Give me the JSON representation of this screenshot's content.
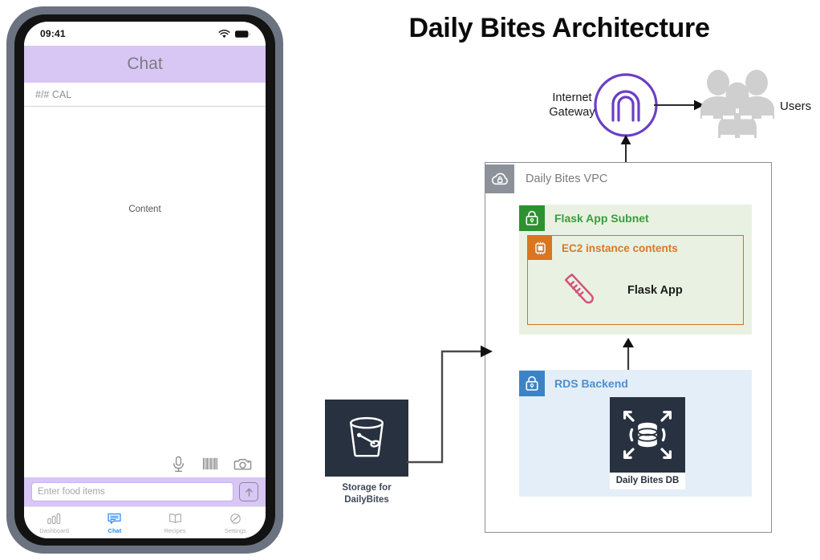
{
  "phone": {
    "status_bar": {
      "time": "09:41",
      "wifi_icon": "wifi-icon",
      "battery_icon": "battery-icon"
    },
    "header": {
      "title": "Chat"
    },
    "cal_row": {
      "text": "#/# CAL"
    },
    "body": {
      "content_label": "Content"
    },
    "media_row": [
      {
        "icon": "microphone-icon",
        "name": "microphone"
      },
      {
        "icon": "barcode-icon",
        "name": "barcode"
      },
      {
        "icon": "camera-icon",
        "name": "camera"
      }
    ],
    "composer": {
      "input_placeholder": "Enter food items",
      "input_value": "",
      "send_icon": "arrow-up-icon"
    },
    "tabs": [
      {
        "label": "Dashboard",
        "icon": "bar-chart-icon",
        "active": false
      },
      {
        "label": "Chat",
        "icon": "chat-bubble-icon",
        "active": true
      },
      {
        "label": "Recipes",
        "icon": "book-icon",
        "active": false
      },
      {
        "label": "Settings",
        "icon": "gear-icon",
        "active": false
      }
    ],
    "colors": {
      "accent_purple": "#d8c6f5",
      "active_tab": "#2d8cf5",
      "inactive_tab": "#aeaeb2"
    }
  },
  "diagram": {
    "title": "Daily Bites Architecture",
    "internet_gateway": {
      "label": "Internet\nGateway",
      "line1": "Internet",
      "line2": "Gateway",
      "icon": "internet-gateway-icon",
      "color": "#6b3fc4"
    },
    "users": {
      "label": "Users",
      "icon": "users-icon",
      "color": "#cfcfcf"
    },
    "vpc": {
      "title": "Daily Bites VPC",
      "icon": "vpc-cloud-icon",
      "tile_color": "#8d9199",
      "title_color": "#7a7a80",
      "border_color": "#8c8c94"
    },
    "flask_subnet": {
      "title": "Flask App Subnet",
      "icon": "lock-icon",
      "tile_color": "#2c9230",
      "title_color": "#3a9c3e",
      "bg_color": "#e9f2e2"
    },
    "ec2": {
      "title": "EC2 instance contents",
      "icon": "cpu-chip-icon",
      "tile_color": "#d9761f",
      "title_color": "#d9772a",
      "border_color": "#cf7127"
    },
    "flask_app": {
      "label": "Flask App",
      "icon": "flask-tube-icon",
      "color": "#d4527e"
    },
    "rds_subnet": {
      "title": "RDS Backend",
      "icon": "lock-icon",
      "tile_color": "#3c83c6",
      "title_color": "#4a90cf",
      "bg_color": "#e4eef8"
    },
    "database": {
      "label": "Daily Bites DB",
      "icon": "rds-database-icon",
      "box_color": "#27313f"
    },
    "storage": {
      "line1": "Storage for",
      "line2": "DailyBites",
      "icon": "s3-bucket-icon",
      "box_color": "#27313f"
    },
    "arrows": [
      {
        "name": "gateway-to-users",
        "from": "Internet Gateway",
        "to": "Users"
      },
      {
        "name": "vpc-to-gateway",
        "from": "Daily Bites VPC",
        "to": "Internet Gateway"
      },
      {
        "name": "database-to-ec2",
        "from": "Daily Bites DB",
        "to": "EC2 instance contents"
      },
      {
        "name": "storage-to-vpc",
        "from": "Storage for DailyBites",
        "to": "Daily Bites VPC"
      }
    ]
  }
}
